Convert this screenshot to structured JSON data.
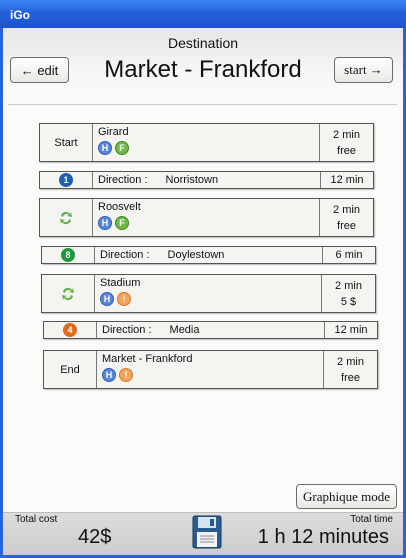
{
  "window": {
    "title": "iGo"
  },
  "header": {
    "label": "Destination",
    "destination": "Market - Frankford",
    "edit_button": "← edit",
    "start_button": "start →"
  },
  "stops": [
    {
      "type": "Start",
      "name": "Girard",
      "badges": [
        "H",
        "F"
      ],
      "time": "2 min",
      "cost": "free"
    },
    {
      "type": "",
      "name": "Roosvelt",
      "badges": [
        "H",
        "F"
      ],
      "time": "2 min",
      "cost": "free",
      "icon": "transfer-icon"
    },
    {
      "type": "",
      "name": "Stadium",
      "badges": [
        "H",
        "!"
      ],
      "time": "2 min",
      "cost": "5 $",
      "icon": "transfer-icon"
    },
    {
      "type": "End",
      "name": "Market - Frankford",
      "badges": [
        "H",
        "!"
      ],
      "time": "2 min",
      "cost": "free"
    }
  ],
  "directions": [
    {
      "line": "1",
      "color": "#1f5fb8",
      "label": "Direction :",
      "dest": "Norristown",
      "time": "12 min"
    },
    {
      "line": "8",
      "color": "#1c9a3c",
      "label": "Direction :",
      "dest": "Doylestown",
      "time": "6 min"
    },
    {
      "line": "4",
      "color": "#e06a1a",
      "label": "Direction :",
      "dest": "Media",
      "time": "12 min"
    }
  ],
  "graph_button": "Graphique mode",
  "footer": {
    "cost_label": "Total cost",
    "cost_value": "42$",
    "time_label": "Total time",
    "time_value": "1 h 12 minutes",
    "save_icon": "floppy-disk-icon"
  },
  "colors": {
    "titlebar": "#2461dc",
    "badge_h": "#5b86d8",
    "badge_f": "#6fba45",
    "badge_warn": "#f3a35a"
  }
}
